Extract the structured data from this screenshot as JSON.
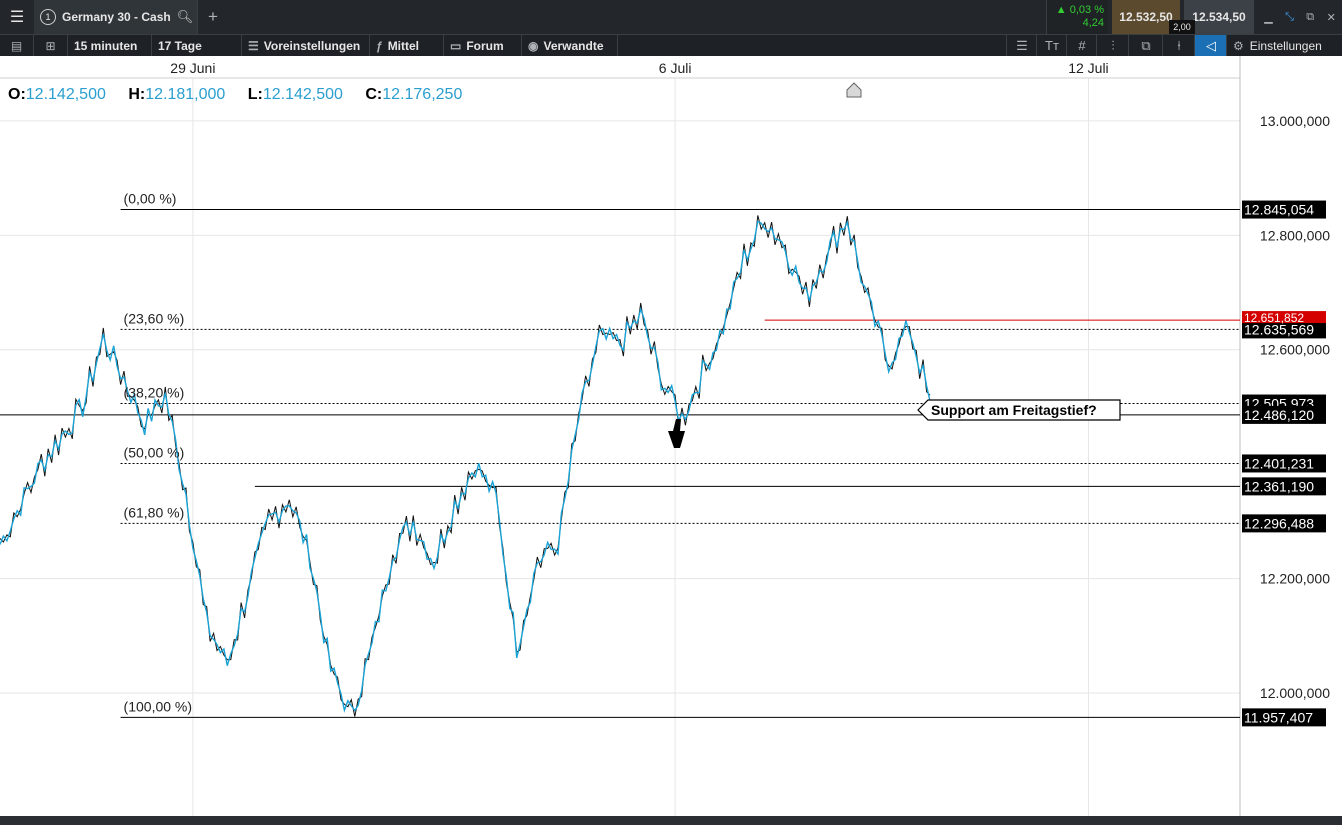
{
  "topbar": {
    "tab_number": "1",
    "instrument": "Germany 30 - Cash",
    "change_pct": "▲ 0,03 %",
    "change_abs": "4,24",
    "bid": "12.532,50",
    "spread": "2,00",
    "ask": "12.534,50"
  },
  "toolbar": {
    "interval": "15 minuten",
    "range": "17 Tage",
    "presets": "Voreinstellungen",
    "indicator": "Mittel",
    "forum": "Forum",
    "related": "Verwandte",
    "settings": "Einstellungen"
  },
  "ohlc": {
    "o_label": "O:",
    "o": "12.142,500",
    "h_label": "H:",
    "h": "12.181,000",
    "l_label": "L:",
    "l": "12.142,500",
    "c_label": "C:",
    "c": "12.176,250"
  },
  "colors": {
    "price": "#1aa3d6",
    "resistance_line": "#d40000",
    "up_change": "#33cc33",
    "active_tool": "#1a6fb5"
  },
  "chart_data": {
    "type": "line",
    "instrument": "Germany 30 - Cash",
    "interval": "15 minuten",
    "x_ticks": [
      "29 Juni",
      "6 Juli",
      "12 Juli"
    ],
    "y_ticks": [
      "13.000,000",
      "12.800,000",
      "12.600,000",
      "12.200,000",
      "12.000,000"
    ],
    "y_tick_values": [
      13000,
      12800,
      12600,
      12200,
      12000
    ],
    "ylim": [
      11785,
      13075
    ],
    "x_domain_days": [
      26.2,
      44.2
    ],
    "x_tick_days": [
      29,
      36,
      42
    ],
    "grid": true,
    "fibonacci": [
      {
        "label": "(0,00 %)",
        "value": 12845.054,
        "price_label": "12.845,054",
        "style": "solid"
      },
      {
        "label": "(23,60 %)",
        "value": 12635.569,
        "price_label": "12.635,569",
        "style": "dotted"
      },
      {
        "label": "(38,20 %)",
        "value": 12505.973,
        "price_label": "12.505,973",
        "style": "dotted"
      },
      {
        "label": "(50,00 %)",
        "value": 12401.231,
        "price_label": "12.401,231",
        "style": "dotted"
      },
      {
        "label": "(61,80 %)",
        "value": 12296.488,
        "price_label": "12.296,488",
        "style": "dotted"
      },
      {
        "label": "(100,00 %)",
        "value": 11957.407,
        "price_label": "11.957,407",
        "style": "solid"
      }
    ],
    "horizontal_lines": [
      {
        "value": 12486.12,
        "price_label": "12.486,120",
        "style": "solid"
      },
      {
        "value": 12361.19,
        "price_label": "12.361,190",
        "style": "solid"
      }
    ],
    "resistance_line": {
      "value": 12651.852,
      "price_label": "12.651,852"
    },
    "annotation": "Support am Freitagstief?",
    "series": [
      {
        "x": [
          26.2,
          26.5,
          26.8,
          27.1,
          27.4,
          27.7,
          28.0,
          28.3,
          28.6,
          28.9,
          29.2,
          29.5,
          29.8,
          30.1,
          30.4,
          30.7,
          31.0,
          31.3,
          31.6,
          31.9,
          32.2,
          32.5,
          32.8,
          33.1,
          33.4,
          33.7,
          34.0,
          34.3,
          34.6,
          34.9,
          35.2,
          35.5,
          35.8,
          36.1,
          36.4,
          36.7,
          37.0,
          37.3,
          37.6,
          37.9,
          38.2,
          38.5,
          38.8,
          39.1,
          39.4,
          39.7
        ],
        "values": [
          12260,
          12330,
          12400,
          12450,
          12500,
          12620,
          12550,
          12470,
          12520,
          12350,
          12120,
          12050,
          12180,
          12300,
          12340,
          12240,
          12040,
          11960,
          12080,
          12250,
          12300,
          12230,
          12330,
          12400,
          12340,
          12080,
          12230,
          12260,
          12480,
          12620,
          12610,
          12660,
          12550,
          12480,
          12560,
          12640,
          12760,
          12830,
          12780,
          12690,
          12770,
          12830,
          12680,
          12580,
          12640,
          12510
        ]
      }
    ]
  }
}
